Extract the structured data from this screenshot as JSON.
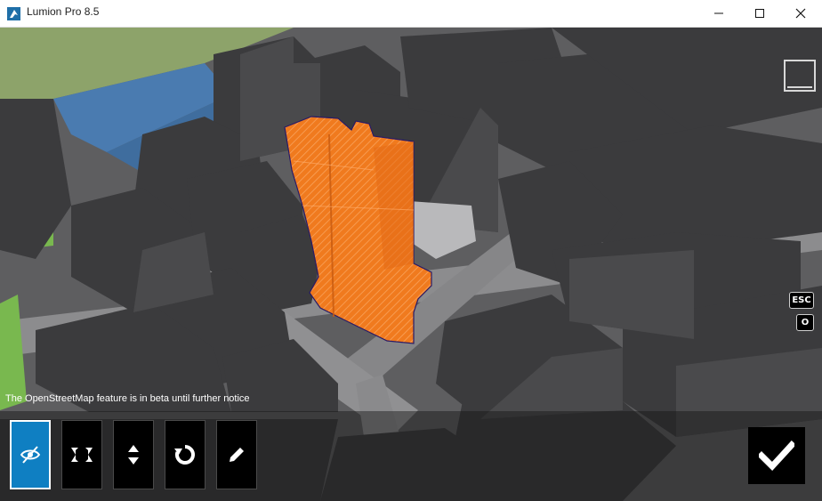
{
  "window": {
    "title": "Lumion Pro 8.5",
    "controls": [
      "minimize",
      "maximize",
      "close"
    ]
  },
  "viewport": {
    "beta_notice": "The OpenStreetMap feature is in beta until further notice",
    "keys": {
      "esc": "ESC",
      "o": "O"
    },
    "selected_building_color": "#f07a1e",
    "building_color": "#3b3b3d",
    "water_color": "#4a7bb0",
    "grass_color": "#79b84f"
  },
  "toolbar": {
    "tools": [
      {
        "icon": "visibility-off-icon",
        "active": true
      },
      {
        "icon": "move-icon",
        "active": false
      },
      {
        "icon": "height-icon",
        "active": false
      },
      {
        "icon": "rotate-icon",
        "active": false
      },
      {
        "icon": "edit-icon",
        "active": false
      }
    ],
    "confirm_icon": "checkmark-icon",
    "active_color": "#0f7fc2"
  }
}
